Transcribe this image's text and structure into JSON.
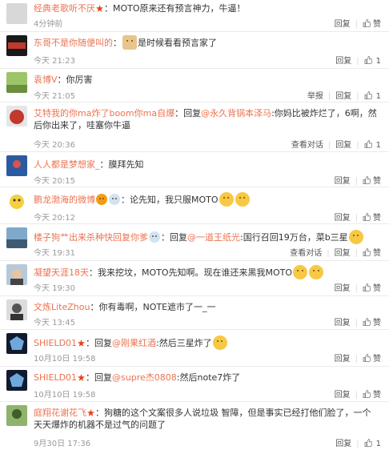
{
  "actions": {
    "reply": "回复",
    "like": "赞",
    "report": "举报",
    "view_dialog": "查看对话"
  },
  "colors": {
    "username": "#eb7350",
    "time": "#999999",
    "divider": "#ebebeb",
    "emoji": "#f7c843"
  },
  "comments": [
    {
      "user": "经典老歌听不厌",
      "badge": "vip-star",
      "text": "：MOTO原来还有预言神力，牛逼！",
      "time": "4分钟前",
      "report": "",
      "view_dialog": "",
      "likes": ""
    },
    {
      "user": "东哥不是你随便叫的",
      "text": "：",
      "emoji_name": "doge-emoji",
      "text2": "是时候看看预言家了",
      "time": "今天 21:23",
      "report": "",
      "view_dialog": "",
      "likes": "1"
    },
    {
      "user": "袁博V",
      "text": "：你厉害",
      "time": "今天 21:05",
      "report": "举报",
      "view_dialog": "",
      "likes": "1"
    },
    {
      "user": "艾特我的你ma炸了boom你ma自爆",
      "text_pre": "：回复",
      "mention": "@永久背锅本泽马",
      "text": ":你妈比被炸烂了，6啊，然后你出来了，哇塞你牛逼",
      "time": "今天 20:36",
      "report": "",
      "view_dialog": "查看对话",
      "likes": "1"
    },
    {
      "user": "人人都是梦想家_",
      "text": "：膜拜先知",
      "time": "今天 20:15",
      "report": "",
      "view_dialog": "",
      "likes": ""
    },
    {
      "user": "鹏龙渤海的微博",
      "text": "：论先知，我只服MOTO",
      "time": "今天 20:12",
      "report": "",
      "view_dialog": "",
      "likes": ""
    },
    {
      "user": "楼子狗艹出来杀种快回复你爹",
      "text_pre": "：回复",
      "mention": "@一道王纸光",
      "text": ":国行召回19万台，菜b三星",
      "time": "今天 19:31",
      "report": "",
      "view_dialog": "查看对话",
      "likes": ""
    },
    {
      "user": "凝望天涯18天",
      "text": "：我来挖坟，MOTO先知啊。现在谁还来黑我MOTO",
      "time": "今天 19:30",
      "report": "",
      "view_dialog": "",
      "likes": ""
    },
    {
      "user": "文炼LiteZhou",
      "text": "：你有毒啊，NOTE遮市了一_一",
      "time": "今天 13:45",
      "report": "",
      "view_dialog": "",
      "likes": ""
    },
    {
      "user": "SHIELD01",
      "badge": "vip-star",
      "text_pre": "：回复",
      "mention": "@刚果红酒",
      "text": ":然后三星炸了",
      "time": "10月10日 19:58",
      "report": "",
      "view_dialog": "",
      "likes": ""
    },
    {
      "user": "SHIELD01",
      "badge": "vip-star",
      "text_pre": "：回复",
      "mention": "@supre杰0808",
      "text": ":然后note7炸了",
      "time": "10月10日 19:58",
      "report": "",
      "view_dialog": "",
      "likes": ""
    },
    {
      "user": "庭翔花谢花飞",
      "text": "：狗糖的这个文案很多人说垃圾 智障，但是事实已经打他们脸了，一个天天爆炸的机器不是过气的问题了",
      "time": "9月30日 17:36",
      "report": "",
      "view_dialog": "",
      "likes": "1"
    }
  ]
}
